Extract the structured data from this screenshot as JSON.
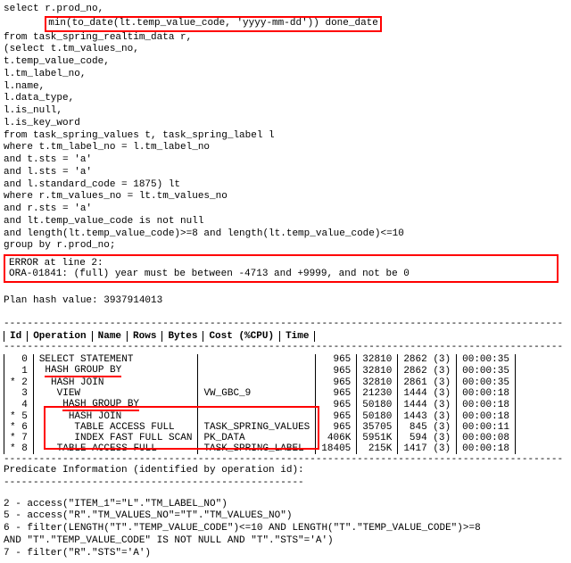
{
  "sql": {
    "l1": "select r.prod_no,",
    "l2": "min(to_date(lt.temp_value_code, 'yyyy-mm-dd')) done_date",
    "l3": "  from task_spring_realtim_data r,",
    "l4": "       (select t.tm_values_no,",
    "l5": "               t.temp_value_code,",
    "l6": "               l.tm_label_no,",
    "l7": "               l.name,",
    "l8": "               l.data_type,",
    "l9": "               l.is_null,",
    "l10": "               l.is_key_word",
    "l11": "          from task_spring_values t, task_spring_label l",
    "l12": "         where t.tm_label_no = l.tm_label_no",
    "l13": "            and t.sts = 'a'",
    "l14": "            and l.sts = 'a'",
    "l15": "            and l.standard_code = 1875) lt",
    "l16": " where r.tm_values_no = lt.tm_values_no",
    "l17": "   and r.sts = 'a'",
    "l18": "   and lt.temp_value_code is not null",
    "l19": "   and length(lt.temp_value_code)>=8 and length(lt.temp_value_code)<=10",
    "l20": " group by r.prod_no;"
  },
  "error": {
    "l1": "ERROR at line 2:",
    "l2": "ORA-01841: (full) year must be between -4713 and +9999, and not be 0"
  },
  "planHash": "Plan hash value: 3937914013",
  "planHeaders": {
    "id": "Id",
    "op": "Operation",
    "name": "Name",
    "rows": "Rows",
    "bytes": "Bytes",
    "cost": "Cost (%CPU)",
    "time": "Time"
  },
  "planRows": [
    {
      "star": "",
      "id": "0",
      "op": "SELECT STATEMENT",
      "opPad": "",
      "name": "",
      "rows": "965",
      "bytes": "32810",
      "cost": "2862   (3)",
      "time": "00:00:35",
      "ul": false
    },
    {
      "star": "",
      "id": "1",
      "op": "HASH GROUP BY",
      "opPad": " ",
      "name": "",
      "rows": "965",
      "bytes": "32810",
      "cost": "2862   (3)",
      "time": "00:00:35",
      "ul": true
    },
    {
      "star": "*",
      "id": "2",
      "op": "HASH JOIN",
      "opPad": "  ",
      "name": "",
      "rows": "965",
      "bytes": "32810",
      "cost": "2861   (3)",
      "time": "00:00:35",
      "ul": false
    },
    {
      "star": "",
      "id": "3",
      "op": "VIEW",
      "opPad": "   ",
      "name": "VW_GBC_9",
      "rows": "965",
      "bytes": "21230",
      "cost": "1444   (3)",
      "time": "00:00:18",
      "ul": false
    },
    {
      "star": "",
      "id": "4",
      "op": "HASH GROUP BY",
      "opPad": "    ",
      "name": "",
      "rows": "965",
      "bytes": "50180",
      "cost": "1444   (3)",
      "time": "00:00:18",
      "ul": true
    },
    {
      "star": "*",
      "id": "5",
      "op": "HASH JOIN",
      "opPad": "     ",
      "name": "",
      "rows": "965",
      "bytes": "50180",
      "cost": "1443   (3)",
      "time": "00:00:18",
      "ul": false
    },
    {
      "star": "*",
      "id": "6",
      "op": "TABLE ACCESS FULL",
      "opPad": "      ",
      "name": "TASK_SPRING_VALUES",
      "rows": "965",
      "bytes": "35705",
      "cost": "845   (3)",
      "time": "00:00:11",
      "ul": false
    },
    {
      "star": "*",
      "id": "7",
      "op": "INDEX FAST FULL SCAN",
      "opPad": "      ",
      "name": "PK_DATA",
      "rows": "406K",
      "bytes": "5951K",
      "cost": "594   (3)",
      "time": "00:00:08",
      "ul": false
    },
    {
      "star": "*",
      "id": "8",
      "op": "TABLE ACCESS FULL",
      "opPad": "   ",
      "name": "TASK_SPRING_LABEL",
      "rows": "18405",
      "bytes": "215K",
      "cost": "1417   (3)",
      "time": "00:00:18",
      "ul": false
    }
  ],
  "predicate": {
    "title": "Predicate Information (identified by operation id):",
    "l1": "   2 - access(\"ITEM_1\"=\"L\".\"TM_LABEL_NO\")",
    "l2": "   5 - access(\"R\".\"TM_VALUES_NO\"=\"T\".\"TM_VALUES_NO\")",
    "l3": "   6 - filter(LENGTH(\"T\".\"TEMP_VALUE_CODE\")<=10 AND LENGTH(\"T\".\"TEMP_VALUE_CODE\")>=8",
    "l4": "              AND \"T\".\"TEMP_VALUE_CODE\" IS NOT NULL AND \"T\".\"STS\"='A')",
    "l5": "   7 - filter(\"R\".\"STS\"='A')"
  }
}
